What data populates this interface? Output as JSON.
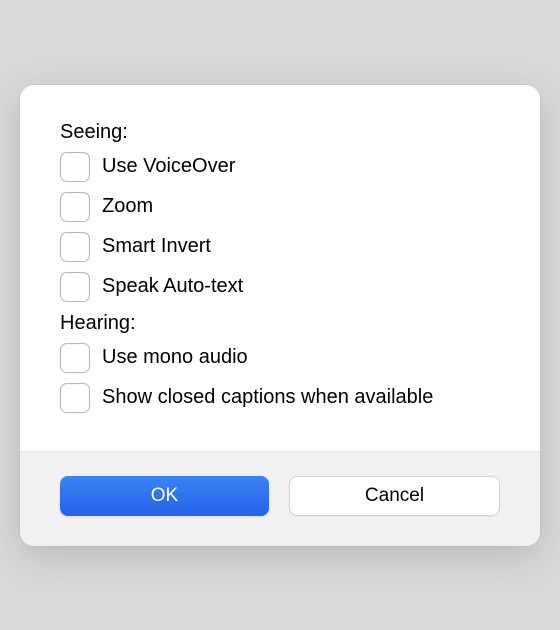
{
  "sections": {
    "seeing": {
      "heading": "Seeing:",
      "items": [
        {
          "label": "Use VoiceOver"
        },
        {
          "label": "Zoom"
        },
        {
          "label": "Smart Invert"
        },
        {
          "label": "Speak Auto-text"
        }
      ]
    },
    "hearing": {
      "heading": "Hearing:",
      "items": [
        {
          "label": "Use mono audio"
        },
        {
          "label": "Show closed captions when available"
        }
      ]
    }
  },
  "buttons": {
    "ok": "OK",
    "cancel": "Cancel"
  }
}
